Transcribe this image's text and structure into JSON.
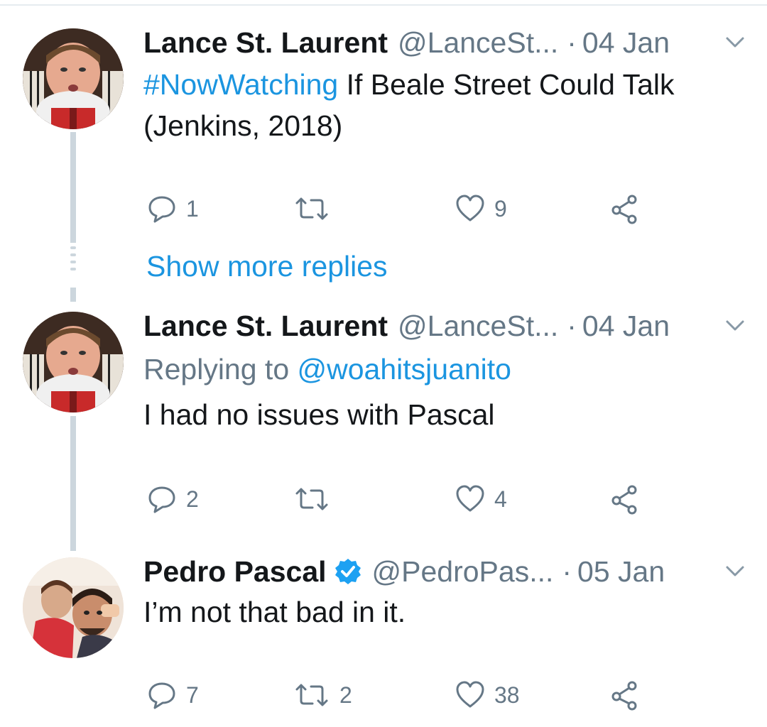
{
  "tweets": [
    {
      "name": "Lance St. Laurent",
      "handle": "@LanceSt...",
      "separator": "·",
      "date": "04 Jan",
      "hashtag": "#NowWatching",
      "text": " If Beale Street Could Talk (Jenkins, 2018)",
      "replies": "1",
      "retweets": "",
      "likes": "9"
    },
    {
      "name": "Lance St. Laurent",
      "handle": "@LanceSt...",
      "separator": "·",
      "date": "04 Jan",
      "replying_prefix": "Replying to ",
      "replying_to": "@woahitsjuanito",
      "text": "I had no issues with Pascal",
      "replies": "2",
      "retweets": "",
      "likes": "4"
    },
    {
      "name": "Pedro Pascal",
      "handle": "@PedroPas...",
      "separator": "·",
      "date": "05 Jan",
      "text": "I’m not that bad in it.",
      "replies": "7",
      "retweets": "2",
      "likes": "38"
    }
  ],
  "show_more_replies": "Show more replies",
  "colors": {
    "link": "#1b95e0",
    "secondary": "#657786",
    "thread": "#ccd6dd"
  },
  "icons": [
    "reply-icon",
    "retweet-icon",
    "like-icon",
    "share-icon",
    "chevron-down-icon",
    "verified-badge-icon"
  ]
}
